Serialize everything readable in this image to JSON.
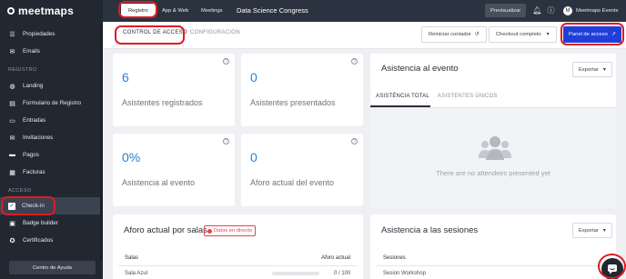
{
  "brand": {
    "name": "meetmaps"
  },
  "sidebar": {
    "top_items": [
      {
        "label": "Propiedades",
        "icon": "list-icon"
      },
      {
        "label": "Emails",
        "icon": "mail-icon"
      }
    ],
    "section_registro": "REGISTRO",
    "registro_items": [
      {
        "label": "Landing",
        "icon": "landing-icon"
      },
      {
        "label": "Formulario de Registro",
        "icon": "form-icon"
      },
      {
        "label": "Entradas",
        "icon": "ticket-icon"
      },
      {
        "label": "Invitaciones",
        "icon": "invitation-icon"
      },
      {
        "label": "Pagos",
        "icon": "payment-icon"
      },
      {
        "label": "Facturas",
        "icon": "invoice-icon"
      }
    ],
    "section_acceso": "ACCESO",
    "acceso_items": [
      {
        "label": "Check-in",
        "icon": "checkin-icon",
        "active": true
      },
      {
        "label": "Badge builder",
        "icon": "badge-icon"
      },
      {
        "label": "Certificados",
        "icon": "certificate-icon"
      }
    ],
    "help_label": "Centro de Ayuda"
  },
  "topbar": {
    "tabs": [
      {
        "label": "Registro",
        "active": true
      },
      {
        "label": "App & Web"
      },
      {
        "label": "Meetings"
      }
    ],
    "event_title": "Data Science Congress",
    "preview_label": "Previsualizar",
    "user_name": "Meetmaps Events",
    "user_initial": "M"
  },
  "subheader": {
    "tabs": [
      {
        "label": "CONTROL DE ACCESO",
        "active": true
      },
      {
        "label": "CONFIGURACIÓN"
      }
    ],
    "reset_label": "Reiniciar contador",
    "checkout_label": "Checkout completo",
    "panel_label": "Panel de acceso"
  },
  "stats": [
    {
      "value": "6",
      "label": "Asistentes registrados"
    },
    {
      "value": "0",
      "label": "Asistentes presentados"
    },
    {
      "value": "0%",
      "label": "Asistencia al evento"
    },
    {
      "value": "0",
      "label": "Aforo actual del evento"
    }
  ],
  "attendance_panel": {
    "title": "Asistencia al evento",
    "export_label": "Exportar",
    "tabs": [
      {
        "label": "ASISTÉNCIA TOTAL",
        "active": true
      },
      {
        "label": "ASISTENTES ÚNICOS"
      }
    ],
    "empty_text": "There are no attendees presented yet"
  },
  "rooms_panel": {
    "title": "Aforo actual por salas",
    "live_label": "Datos en directo",
    "col_rooms": "Salas",
    "col_capacity": "Aforo actual",
    "rows": [
      {
        "name": "Sala Azul",
        "capacity": "0 / 100",
        "fill": 0
      }
    ]
  },
  "sessions_panel": {
    "title": "Asistencia a las sesiones",
    "export_label": "Exportar",
    "col_sessions": "Sesiones",
    "rows": [
      {
        "name": "Sesion Workshop"
      }
    ]
  },
  "colors": {
    "accent": "#1f3fd8",
    "stat_number": "#2a7fd1",
    "highlight": "#e01a22",
    "sidebar_bg": "#222831"
  }
}
